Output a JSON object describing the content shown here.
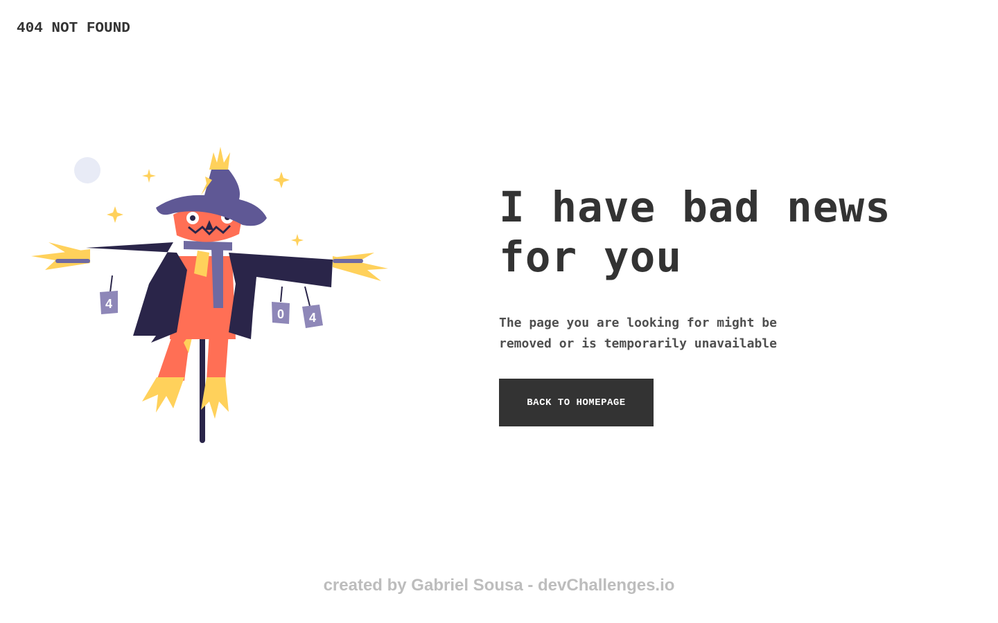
{
  "header": {
    "brand": "404 NOT FOUND"
  },
  "main": {
    "headline_line1": "I have bad news",
    "headline_line2": "for you",
    "subtext_line1": "The page you are looking for might be",
    "subtext_line2": "removed or is temporarily unavailable",
    "cta_label": "BACK TO HOMEPAGE"
  },
  "illustration": {
    "subject": "scarecrow-illustration",
    "can_labels": [
      "4",
      "0",
      "4"
    ],
    "colors": {
      "hat": "#5f5895",
      "coat": "#2a2549",
      "face": "#ff6f55",
      "straw": "#ffd15b",
      "scarf": "#6f6aa1",
      "can": "#8e87b8",
      "moon": "#e8ebf6"
    }
  },
  "footer": {
    "credit": "created by Gabriel Sousa - devChallenges.io"
  },
  "colors": {
    "text_primary": "#333333",
    "text_secondary": "#4f4f4f",
    "button_bg": "#333333",
    "button_text": "#ffffff",
    "footer_text": "#bdbdbd"
  }
}
